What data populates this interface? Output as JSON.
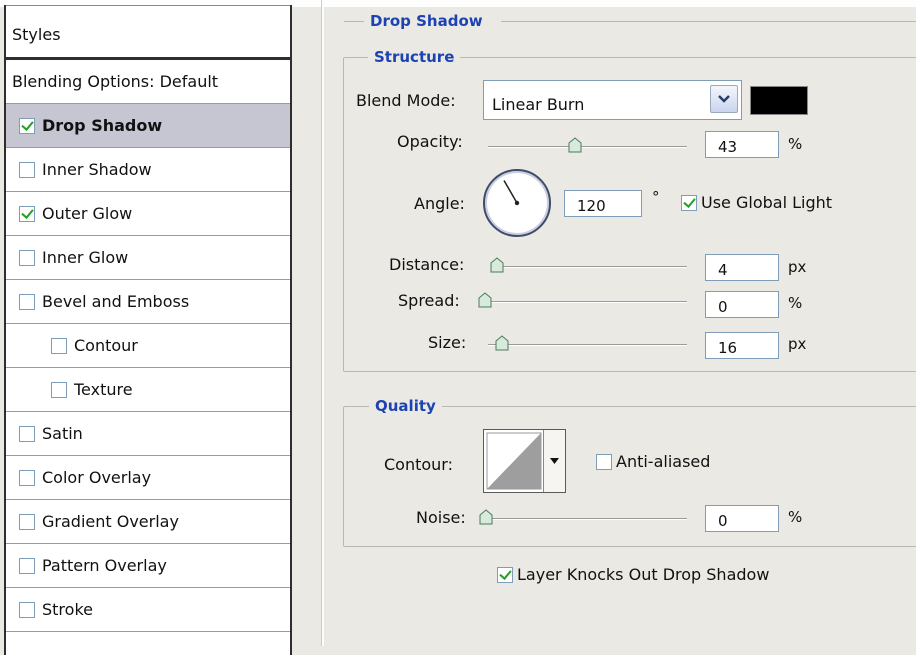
{
  "styles_panel": {
    "header": "Styles",
    "blending_options": "Blending Options: Default",
    "items": [
      {
        "label": "Drop Shadow",
        "checked": true,
        "selected": true,
        "sub": false
      },
      {
        "label": "Inner Shadow",
        "checked": false,
        "selected": false,
        "sub": false
      },
      {
        "label": "Outer Glow",
        "checked": true,
        "selected": false,
        "sub": false
      },
      {
        "label": "Inner Glow",
        "checked": false,
        "selected": false,
        "sub": false
      },
      {
        "label": "Bevel and Emboss",
        "checked": false,
        "selected": false,
        "sub": false
      },
      {
        "label": "Contour",
        "checked": false,
        "selected": false,
        "sub": true
      },
      {
        "label": "Texture",
        "checked": false,
        "selected": false,
        "sub": true
      },
      {
        "label": "Satin",
        "checked": false,
        "selected": false,
        "sub": false
      },
      {
        "label": "Color Overlay",
        "checked": false,
        "selected": false,
        "sub": false
      },
      {
        "label": "Gradient Overlay",
        "checked": false,
        "selected": false,
        "sub": false
      },
      {
        "label": "Pattern Overlay",
        "checked": false,
        "selected": false,
        "sub": false
      },
      {
        "label": "Stroke",
        "checked": false,
        "selected": false,
        "sub": false
      }
    ]
  },
  "drop_shadow": {
    "title": "Drop Shadow",
    "structure": {
      "title": "Structure",
      "blend_mode": {
        "label": "Blend Mode:",
        "value": "Linear Burn",
        "color": "#000000"
      },
      "opacity": {
        "label": "Opacity:",
        "value": "43",
        "unit": "%",
        "fraction": 0.43
      },
      "angle": {
        "label": "Angle:",
        "value": "120",
        "unit": "°",
        "degrees": 120,
        "use_global_light": {
          "label": "Use Global Light",
          "checked": true
        }
      },
      "distance": {
        "label": "Distance:",
        "value": "4",
        "unit": "px",
        "fraction": 0.02
      },
      "spread": {
        "label": "Spread:",
        "value": "0",
        "unit": "%",
        "fraction": 0.0
      },
      "size": {
        "label": "Size:",
        "value": "16",
        "unit": "px",
        "fraction": 0.065
      }
    },
    "quality": {
      "title": "Quality",
      "contour": {
        "label": "Contour:",
        "anti_aliased": {
          "label": "Anti-aliased",
          "checked": false
        }
      },
      "noise": {
        "label": "Noise:",
        "value": "0",
        "unit": "%",
        "fraction": 0.0
      }
    },
    "layer_knocks_out": {
      "label": "Layer Knocks Out Drop Shadow",
      "checked": true
    }
  },
  "icons": {
    "dropdown": "chevron-down-icon",
    "checkmark": "checkmark-icon",
    "slider": "slider-thumb-icon"
  },
  "colors": {
    "title_blue": "#1d43b3",
    "selected_row": "#c6c5d2",
    "check_green": "#21a121",
    "shadow_color": "#000000"
  }
}
